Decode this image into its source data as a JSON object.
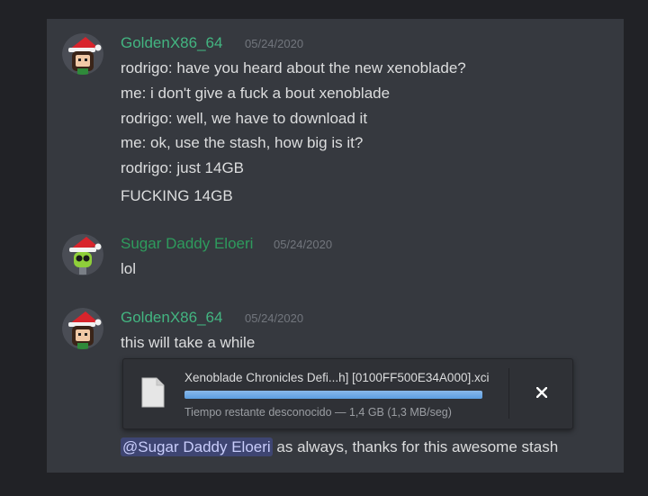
{
  "messages": [
    {
      "username": "GoldenX86_64",
      "timestamp": "05/24/2020",
      "lines": [
        "rodrigo: have you heard about the new xenoblade?",
        "me: i don't give a fuck a bout xenoblade",
        "rodrigo: well, we have to download it",
        "me: ok, use the stash, how big is it?",
        "rodrigo: just 14GB",
        "FUCKING 14GB"
      ]
    },
    {
      "username": "Sugar Daddy Eloeri",
      "timestamp": "05/24/2020",
      "lines": [
        "lol"
      ]
    },
    {
      "username": "GoldenX86_64",
      "timestamp": "05/24/2020",
      "lines": [
        "this will take a while"
      ]
    }
  ],
  "download": {
    "filename": "Xenoblade Chronicles Defi...h] [0100FF500E34A000].xci",
    "status": "Tiempo restante desconocido — 1,4 GB (1,3 MB/seg)",
    "progress": 1.0,
    "close_label": "×"
  },
  "mention": {
    "tag": "@Sugar Daddy Eloeri",
    "text": " as always, thanks for this awesome stash"
  },
  "colors": {
    "golden_name": "#43b581",
    "eloeri_name": "#2e9b5d",
    "mention_bg": "#3e4572",
    "progress_fill": "#6aa8e6"
  }
}
